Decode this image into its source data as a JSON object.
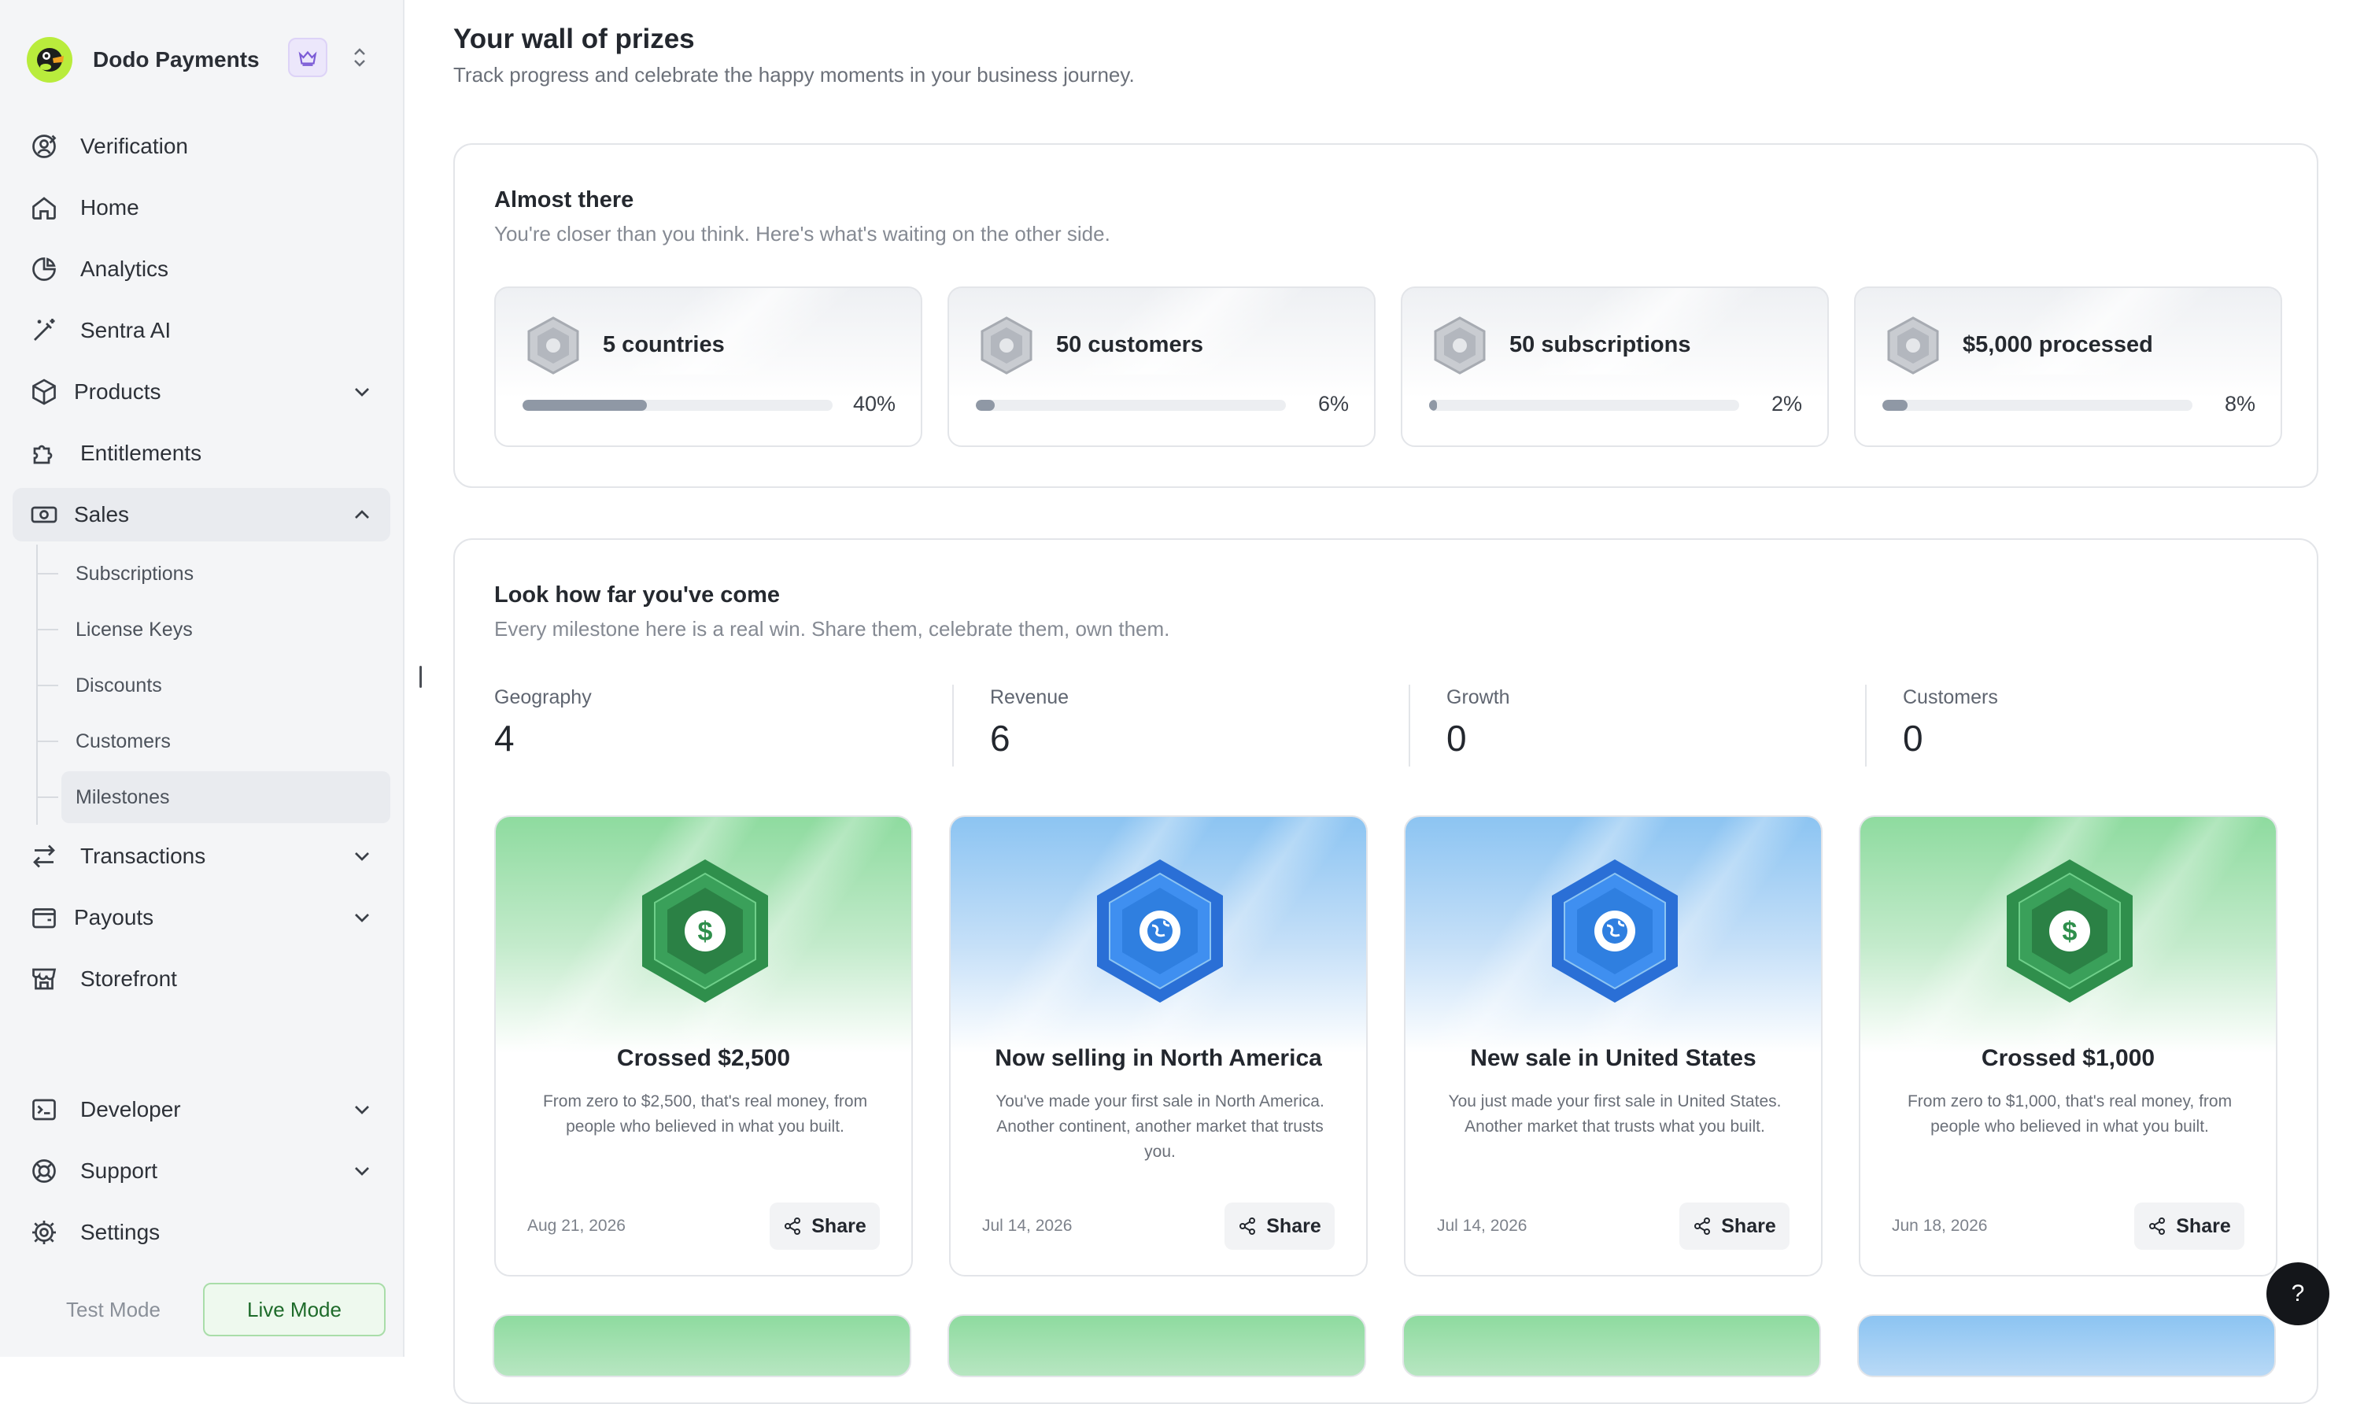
{
  "sidebar": {
    "brand_name": "Dodo Payments",
    "nav": [
      {
        "label": "Verification",
        "icon": "verification-icon"
      },
      {
        "label": "Home",
        "icon": "home-icon"
      },
      {
        "label": "Analytics",
        "icon": "analytics-icon"
      },
      {
        "label": "Sentra AI",
        "icon": "sparkle-icon"
      },
      {
        "label": "Products",
        "icon": "box-icon"
      },
      {
        "label": "Entitlements",
        "icon": "puzzle-icon"
      },
      {
        "label": "Sales",
        "icon": "cash-icon"
      },
      {
        "label": "Transactions",
        "icon": "arrows-icon"
      },
      {
        "label": "Payouts",
        "icon": "wallet-icon"
      },
      {
        "label": "Storefront",
        "icon": "store-icon"
      },
      {
        "label": "Developer",
        "icon": "terminal-icon"
      },
      {
        "label": "Support",
        "icon": "lifebuoy-icon"
      },
      {
        "label": "Settings",
        "icon": "gear-icon"
      }
    ],
    "sales_sub": [
      "Subscriptions",
      "License Keys",
      "Discounts",
      "Customers",
      "Milestones"
    ],
    "modes": {
      "test": "Test Mode",
      "live": "Live Mode"
    }
  },
  "header": {
    "title": "Your wall of prizes",
    "subtitle": "Track progress and celebrate the happy moments in your business journey."
  },
  "almost": {
    "title": "Almost there",
    "subtitle": "You're closer than you think. Here's what's waiting on the other side.",
    "items": [
      {
        "label": "5 countries",
        "percent_text": "40%",
        "progress": 0.4
      },
      {
        "label": "50 customers",
        "percent_text": "6%",
        "progress": 0.06
      },
      {
        "label": "50 subscriptions",
        "percent_text": "2%",
        "progress": 0.02
      },
      {
        "label": "$5,000 processed",
        "percent_text": "8%",
        "progress": 0.08
      }
    ]
  },
  "come": {
    "title": "Look how far you've come",
    "subtitle": "Every milestone here is a real win. Share them, celebrate them, own them.",
    "stats": [
      {
        "label": "Geography",
        "value": "4"
      },
      {
        "label": "Revenue",
        "value": "6"
      },
      {
        "label": "Growth",
        "value": "0"
      },
      {
        "label": "Customers",
        "value": "0"
      }
    ],
    "milestones": [
      {
        "title": "Crossed $2,500",
        "desc": "From zero to $2,500, that's real money, from people who believed in what you built.",
        "date": "Aug 21, 2026",
        "theme": "green",
        "icon": "dollar-badge-icon"
      },
      {
        "title": "Now selling in North America",
        "desc": "You've made your first sale in North America. Another continent, another market that trusts you.",
        "date": "Jul 14, 2026",
        "theme": "blue",
        "icon": "globe-badge-icon"
      },
      {
        "title": "New sale in United States",
        "desc": "You just made your first sale in United States. Another market that trusts what you built.",
        "date": "Jul 14, 2026",
        "theme": "blue",
        "icon": "globe-badge-icon"
      },
      {
        "title": "Crossed $1,000",
        "desc": "From zero to $1,000, that's real money, from people who believed in what you built.",
        "date": "Jun 18, 2026",
        "theme": "green",
        "icon": "dollar-badge-icon"
      }
    ],
    "share_label": "Share"
  },
  "help_label": "?",
  "colors": {
    "green": "#2e8b4a",
    "blue": "#2f7fe0",
    "live_border": "#a9dda9"
  }
}
